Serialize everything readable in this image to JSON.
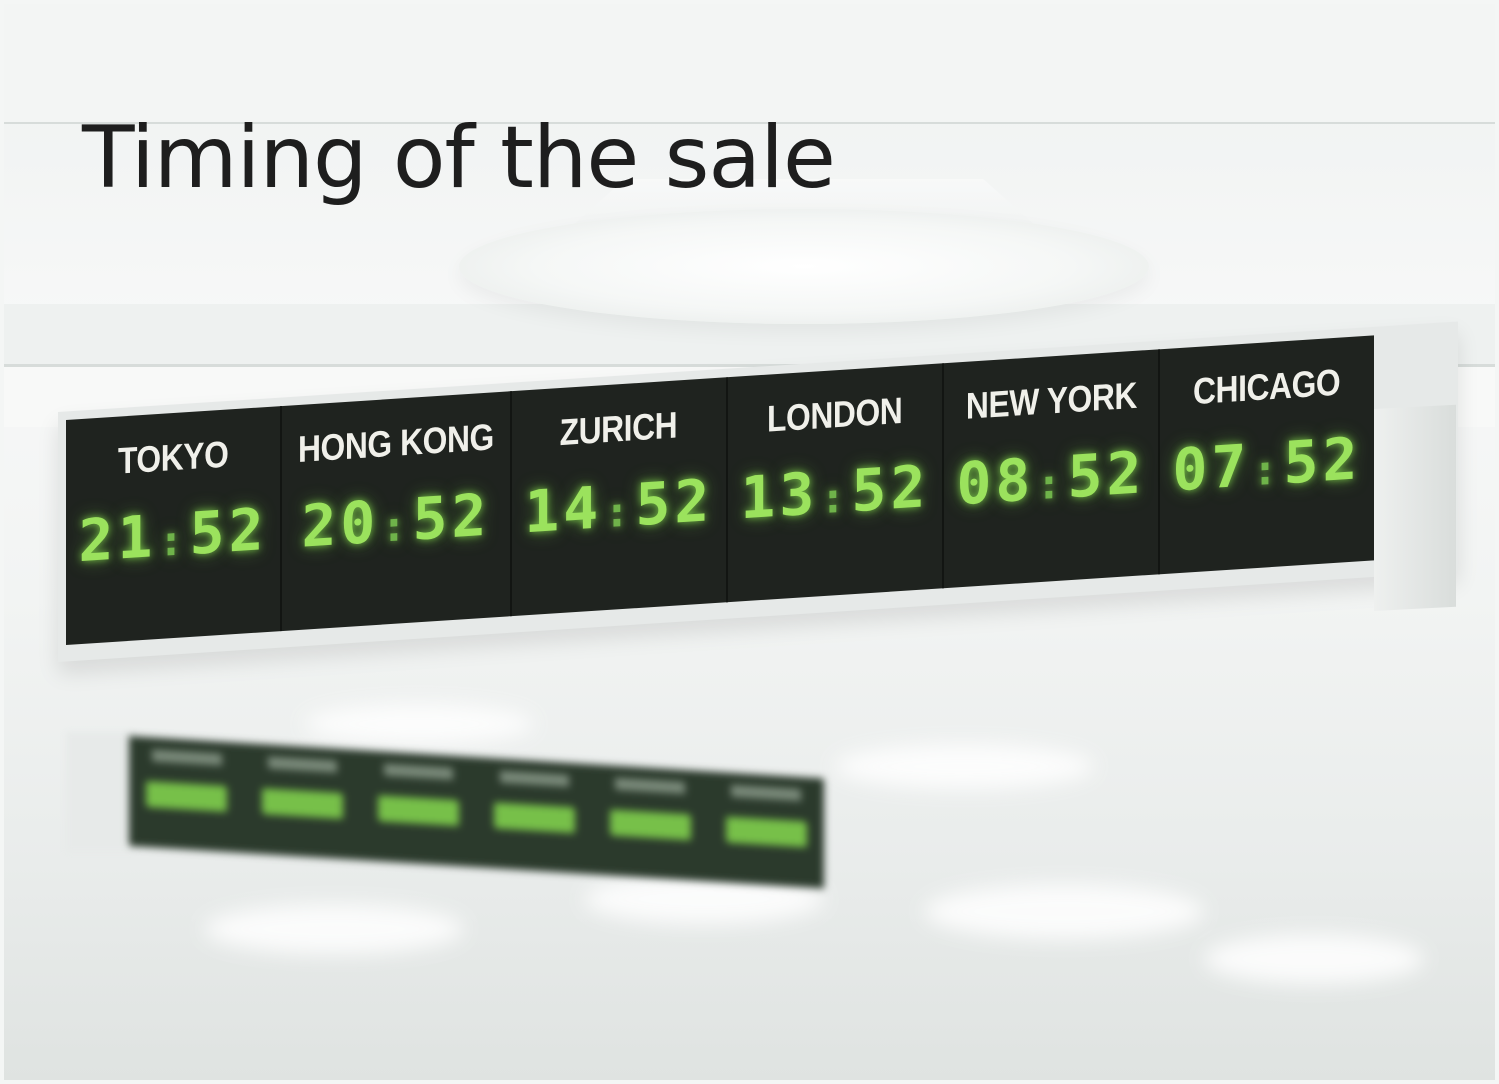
{
  "slide": {
    "title": "Timing of the sale"
  },
  "board": {
    "cities": [
      {
        "name": "TOKYO",
        "hours": "21",
        "minutes": "52"
      },
      {
        "name": "HONG KONG",
        "hours": "20",
        "minutes": "52"
      },
      {
        "name": "ZURICH",
        "hours": "14",
        "minutes": "52"
      },
      {
        "name": "LONDON",
        "hours": "13",
        "minutes": "52"
      },
      {
        "name": "NEW YORK",
        "hours": "08",
        "minutes": "52"
      },
      {
        "name": "CHICAGO",
        "hours": "07",
        "minutes": "52"
      }
    ],
    "display_color": "#9be25d",
    "board_color": "#1f231f"
  }
}
